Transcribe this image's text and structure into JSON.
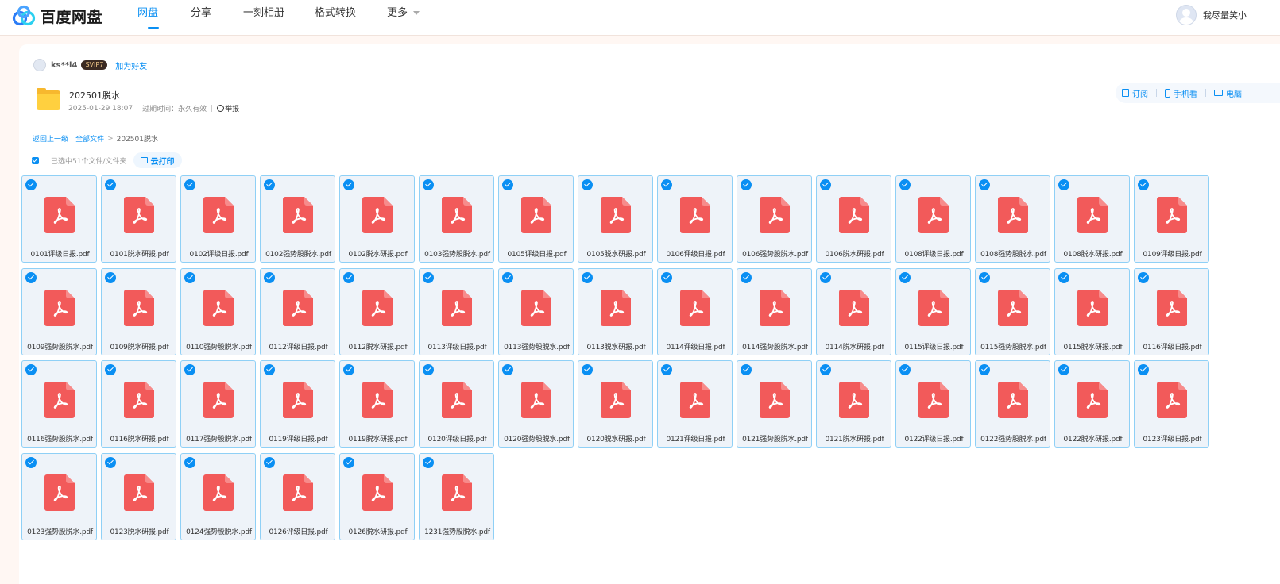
{
  "app": {
    "logo_text": "百度网盘",
    "nav": [
      "网盘",
      "分享",
      "一刻相册",
      "格式转换",
      "更多"
    ],
    "active_nav": "网盘",
    "username": "我尽量笑小"
  },
  "share": {
    "sharer_name": "ks**l4",
    "vip_badge": "SVIP7",
    "add_friend": "加为好友",
    "folder_name": "202501脱水",
    "created_time": "2025-01-29 18:07",
    "expire_label": "过期时间：永久有效",
    "report": "举报",
    "actions": [
      "订阅",
      "手机看",
      "电脑"
    ]
  },
  "breadcrumb": {
    "back": "返回上一级",
    "all_files": "全部文件",
    "current": "202501脱水"
  },
  "selection": {
    "count_text": "已选中51个文件/文件夹",
    "cloud_print": "云打印"
  },
  "colors": {
    "accent": "#0a8ff3",
    "pdf_red": "#f25a5a",
    "folder_yellow": "#ffd03f"
  },
  "files": [
    "0101评级日报.pdf",
    "0101脱水研报.pdf",
    "0102评级日报.pdf",
    "0102强势股脱水.pdf",
    "0102脱水研报.pdf",
    "0103强势股脱水.pdf",
    "0105评级日报.pdf",
    "0105脱水研报.pdf",
    "0106评级日报.pdf",
    "0106强势股脱水.pdf",
    "0106脱水研报.pdf",
    "0108评级日报.pdf",
    "0108强势股脱水.pdf",
    "0108脱水研报.pdf",
    "0109评级日报.pdf",
    "0109强势股脱水.pdf",
    "0109脱水研报.pdf",
    "0110强势股脱水.pdf",
    "0112评级日报.pdf",
    "0112脱水研报.pdf",
    "0113评级日报.pdf",
    "0113强势股脱水.pdf",
    "0113脱水研报.pdf",
    "0114评级日报.pdf",
    "0114强势股脱水.pdf",
    "0114脱水研报.pdf",
    "0115评级日报.pdf",
    "0115强势股脱水.pdf",
    "0115脱水研报.pdf",
    "0116评级日报.pdf",
    "0116强势股脱水.pdf",
    "0116脱水研报.pdf",
    "0117强势股脱水.pdf",
    "0119评级日报.pdf",
    "0119脱水研报.pdf",
    "0120评级日报.pdf",
    "0120强势股脱水.pdf",
    "0120脱水研报.pdf",
    "0121评级日报.pdf",
    "0121强势股脱水.pdf",
    "0121脱水研报.pdf",
    "0122评级日报.pdf",
    "0122强势股脱水.pdf",
    "0122脱水研报.pdf",
    "0123评级日报.pdf",
    "0123强势股脱水.pdf",
    "0123脱水研报.pdf",
    "0124强势股脱水.pdf",
    "0126评级日报.pdf",
    "0126脱水研报.pdf",
    "1231强势股脱水.pdf"
  ]
}
